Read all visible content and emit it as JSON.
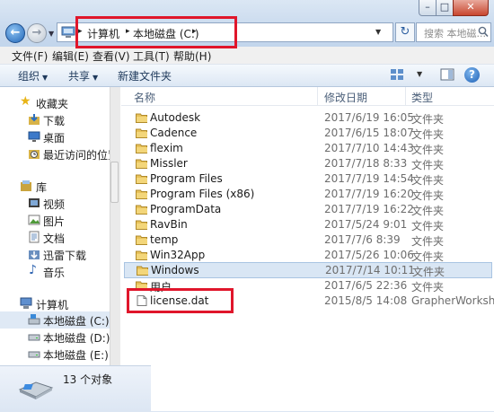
{
  "address_bar": {
    "crumbs": [
      "计算机",
      "本地磁盘 (C:)"
    ]
  },
  "search": {
    "placeholder": "搜索 本地磁..."
  },
  "menu": [
    "文件(F)",
    "编辑(E)",
    "查看(V)",
    "工具(T)",
    "帮助(H)"
  ],
  "toolbar": {
    "organize": "组织",
    "share": "共享",
    "new_folder": "新建文件夹"
  },
  "nav": {
    "favorites_header": "收藏夹",
    "favorites": [
      "下载",
      "桌面",
      "最近访问的位置"
    ],
    "libraries_header": "库",
    "libraries": [
      "视频",
      "图片",
      "文档",
      "迅雷下载",
      "音乐"
    ],
    "computer_header": "计算机",
    "drives": [
      "本地磁盘 (C:)",
      "本地磁盘 (D:)",
      "本地磁盘 (E:)"
    ]
  },
  "columns": {
    "name": "名称",
    "date": "修改日期",
    "type": "类型"
  },
  "files": [
    {
      "name": "Autodesk",
      "date": "2017/6/19 16:05",
      "type": "文件夹",
      "kind": "folder"
    },
    {
      "name": "Cadence",
      "date": "2017/6/15 18:07",
      "type": "文件夹",
      "kind": "folder"
    },
    {
      "name": "flexim",
      "date": "2017/7/10 14:43",
      "type": "文件夹",
      "kind": "folder"
    },
    {
      "name": "Missler",
      "date": "2017/7/18 8:33",
      "type": "文件夹",
      "kind": "folder"
    },
    {
      "name": "Program Files",
      "date": "2017/7/19 14:54",
      "type": "文件夹",
      "kind": "folder"
    },
    {
      "name": "Program Files (x86)",
      "date": "2017/7/19 16:20",
      "type": "文件夹",
      "kind": "folder"
    },
    {
      "name": "ProgramData",
      "date": "2017/7/19 16:22",
      "type": "文件夹",
      "kind": "folder"
    },
    {
      "name": "RavBin",
      "date": "2017/5/24 9:01",
      "type": "文件夹",
      "kind": "folder"
    },
    {
      "name": "temp",
      "date": "2017/7/6 8:39",
      "type": "文件夹",
      "kind": "folder"
    },
    {
      "name": "Win32App",
      "date": "2017/5/26 10:06",
      "type": "文件夹",
      "kind": "folder"
    },
    {
      "name": "Windows",
      "date": "2017/7/14 10:11",
      "type": "文件夹",
      "kind": "folder"
    },
    {
      "name": "用户",
      "date": "2017/6/5 22:36",
      "type": "文件夹",
      "kind": "folder"
    },
    {
      "name": "license.dat",
      "date": "2015/8/5 14:08",
      "type": "GrapherWorksh...",
      "kind": "file"
    }
  ],
  "status": {
    "item_count": "13 个对象"
  },
  "colors": {
    "highlight": "#e0162b",
    "selection": "#d9e6f4",
    "folder": "#e8c25a"
  }
}
